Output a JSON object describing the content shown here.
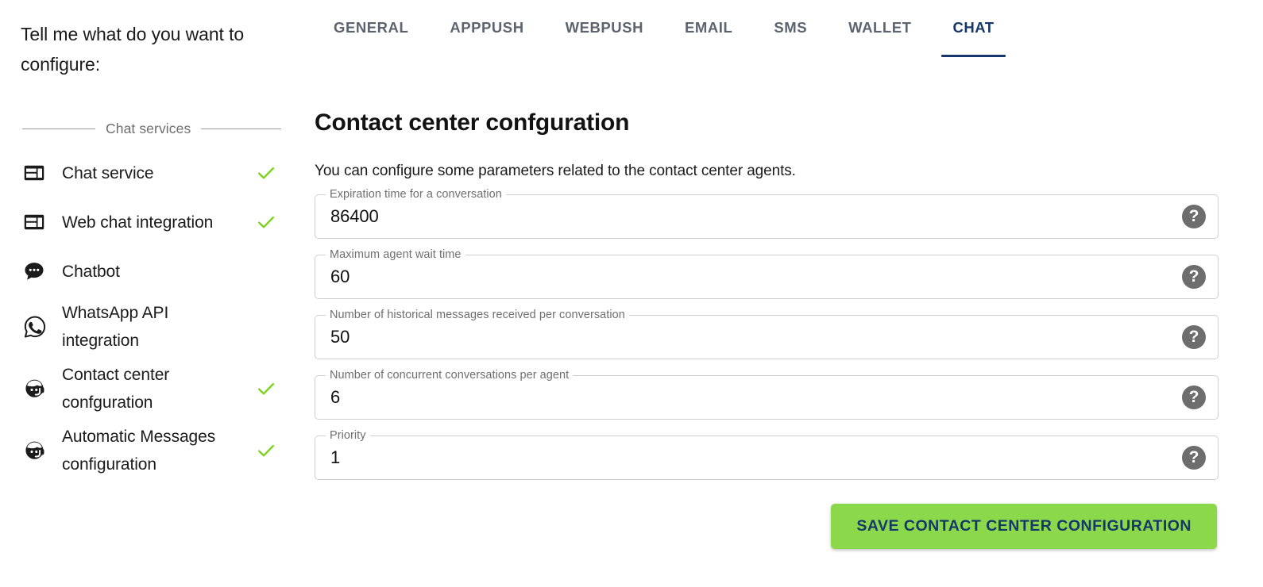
{
  "sidebar": {
    "prompt": "Tell me what do you want to configure:",
    "section_label": "Chat services",
    "items": [
      {
        "label": "Chat service",
        "icon": "web-asset-icon",
        "checked": true
      },
      {
        "label": "Web chat integration",
        "icon": "web-asset-icon",
        "checked": true
      },
      {
        "label": "Chatbot",
        "icon": "chat-bubble-icon",
        "checked": false
      },
      {
        "label_line1": "WhatsApp API",
        "label_line2": "integration",
        "icon": "whatsapp-icon",
        "checked": false
      },
      {
        "label_line1": "Contact center",
        "label_line2": "confguration",
        "icon": "support-agent-icon",
        "checked": true
      },
      {
        "label_line1": "Automatic Messages",
        "label_line2": "configuration",
        "icon": "support-agent-icon",
        "checked": true
      }
    ]
  },
  "tabs": [
    {
      "label": "GENERAL",
      "active": false
    },
    {
      "label": "APPPUSH",
      "active": false
    },
    {
      "label": "WEBPUSH",
      "active": false
    },
    {
      "label": "EMAIL",
      "active": false
    },
    {
      "label": "SMS",
      "active": false
    },
    {
      "label": "WALLET",
      "active": false
    },
    {
      "label": "CHAT",
      "active": true
    }
  ],
  "panel": {
    "title": "Contact center confguration",
    "description": "You can configure some parameters related to the contact center agents.",
    "fields": [
      {
        "label": "Expiration time for a conversation",
        "value": "86400",
        "help": "?"
      },
      {
        "label": "Maximum agent wait time",
        "value": "60",
        "help": "?"
      },
      {
        "label": "Number of historical messages received per conversation",
        "value": "50",
        "help": "?"
      },
      {
        "label": "Number of concurrent conversations per agent",
        "value": "6",
        "help": "?"
      },
      {
        "label": "Priority",
        "value": "1",
        "help": "?"
      }
    ],
    "save_label": "SAVE CONTACT CENTER CONFIGURATION"
  },
  "colors": {
    "accent_navy": "#16376b",
    "save_green": "#8bd94b",
    "check_green": "#7ed321",
    "tab_inactive": "#5c6470",
    "field_border": "#cfcfcf",
    "help_circle": "#6d6d6d"
  }
}
